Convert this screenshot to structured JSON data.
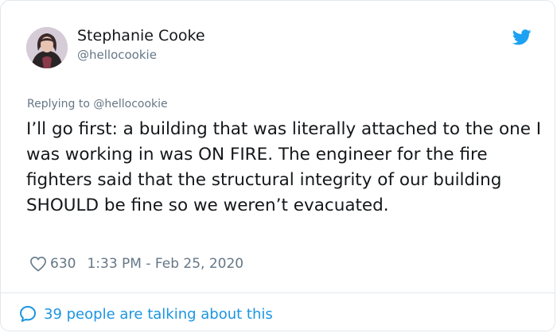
{
  "author": {
    "name": "Stephanie Cooke",
    "handle": "@hellocookie"
  },
  "replying": {
    "prefix": "Replying to",
    "mention": "@hellocookie"
  },
  "tweet": {
    "text": "I’ll go first: a building that was literally attached to the one I was working in was ON FIRE. The engineer for the fire fighters said that the structural integrity of our building SHOULD be fine so we weren’t evacuated."
  },
  "meta": {
    "likes": "630",
    "timestamp": "1:33 PM - Feb 25, 2020"
  },
  "footer": {
    "talking_label": "39 people are talking about this"
  },
  "icons": {
    "brand": "twitter-bird-icon",
    "like": "heart-icon",
    "conversation": "speech-bubble-icon"
  },
  "colors": {
    "accent": "#1b95e0",
    "secondary_text": "#657786",
    "primary_text": "#14171a",
    "border": "#e1e8ed"
  }
}
